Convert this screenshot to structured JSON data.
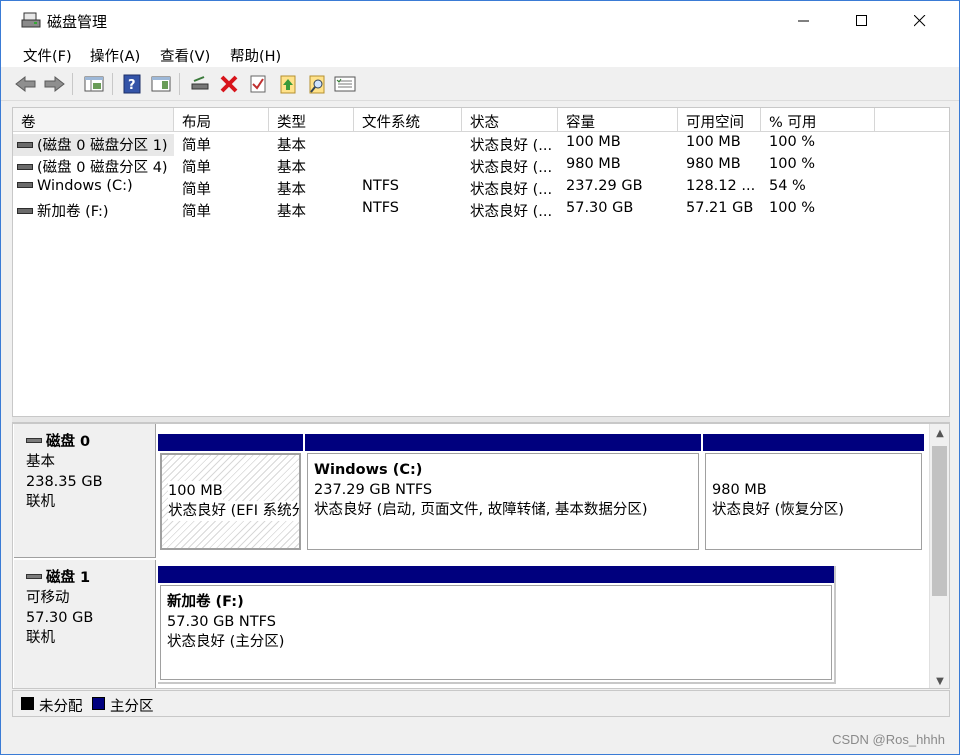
{
  "window": {
    "title": "磁盘管理",
    "controls": {
      "minimize": "minimize",
      "maximize": "maximize",
      "close": "close"
    }
  },
  "menu": [
    "文件(F)",
    "操作(A)",
    "查看(V)",
    "帮助(H)"
  ],
  "toolbar": {
    "icons": [
      "back-arrow-icon",
      "forward-arrow-icon",
      "view-grid-icon",
      "help-icon",
      "console-pane-icon",
      "connect-drive-icon",
      "delete-x-icon",
      "properties-check-icon",
      "folder-up-icon",
      "search-folder-icon",
      "list-details-icon"
    ]
  },
  "volumes": {
    "columns": [
      "卷",
      "布局",
      "类型",
      "文件系统",
      "状态",
      "容量",
      "可用空间",
      "% 可用"
    ],
    "rows": [
      [
        "(磁盘 0 磁盘分区 1)",
        "简单",
        "基本",
        "",
        "状态良好 (...",
        "100 MB",
        "100 MB",
        "100 %"
      ],
      [
        "(磁盘 0 磁盘分区 4)",
        "简单",
        "基本",
        "",
        "状态良好 (...",
        "980 MB",
        "980 MB",
        "100 %"
      ],
      [
        "Windows (C:)",
        "简单",
        "基本",
        "NTFS",
        "状态良好 (...",
        "237.29 GB",
        "128.12 ...",
        "54 %"
      ],
      [
        "新加卷 (F:)",
        "简单",
        "基本",
        "NTFS",
        "状态良好 (...",
        "57.30 GB",
        "57.21 GB",
        "100 %"
      ]
    ]
  },
  "disks": [
    {
      "name": "磁盘 0",
      "type": "基本",
      "size": "238.35 GB",
      "status": "联机",
      "partitions": [
        {
          "title": "",
          "size": "100 MB",
          "status": "状态良好 (EFI 系统分",
          "selected": true
        },
        {
          "title": "Windows  (C:)",
          "size": "237.29 GB NTFS",
          "status": "状态良好 (启动, 页面文件, 故障转储, 基本数据分区)"
        },
        {
          "title": "",
          "size": "980 MB",
          "status": "状态良好 (恢复分区)"
        }
      ]
    },
    {
      "name": "磁盘 1",
      "type": "可移动",
      "size": "57.30 GB",
      "status": "联机",
      "partitions": [
        {
          "title": "新加卷  (F:)",
          "size": "57.30 GB NTFS",
          "status": "状态良好 (主分区)"
        }
      ]
    }
  ],
  "legend": [
    {
      "label": "未分配",
      "color": "#000000"
    },
    {
      "label": "主分区",
      "color": "#00007e"
    }
  ],
  "watermark": "CSDN @Ros_hhhh",
  "colors": {
    "partition_bar": "#00007e",
    "window_bg": "#f0f0f0"
  }
}
